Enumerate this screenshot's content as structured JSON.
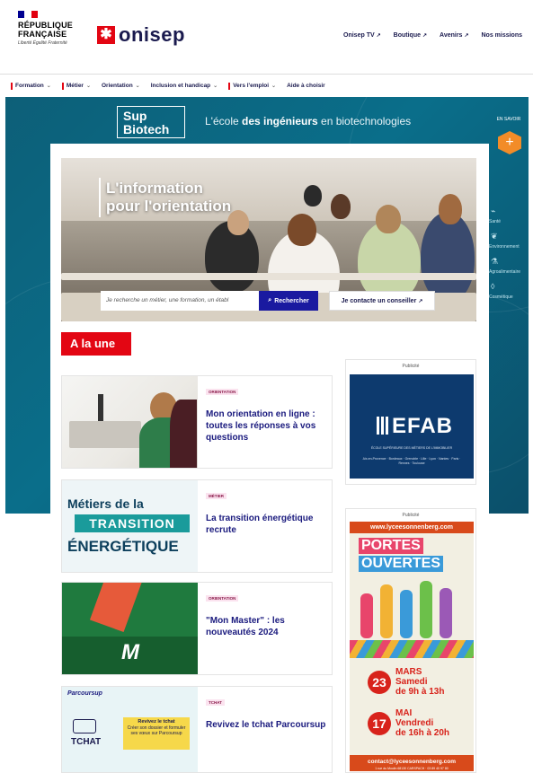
{
  "header": {
    "rf_title_line1": "RÉPUBLIQUE",
    "rf_title_line2": "FRANÇAISE",
    "rf_motto": "Liberté Égalité Fraternité",
    "logo_text": "onisep",
    "toplinks": [
      "Onisep TV",
      "Boutique",
      "Avenirs",
      "Nos missions"
    ]
  },
  "nav": {
    "items": [
      "Formation",
      "Métier",
      "Orientation",
      "Inclusion et handicap",
      "Vers l'emploi",
      "Aide à choisir"
    ]
  },
  "banner": {
    "brand_line1": "Sup",
    "brand_line2": "Biotech",
    "tagline_pre": "L'école ",
    "tagline_bold": "des ingénieurs",
    "tagline_post": " en biotechnologies",
    "side_label": "EN SAVOIR",
    "side_links": [
      "Santé",
      "Environnement",
      "Agroalimentaire",
      "Cosmétique"
    ],
    "colors": {
      "accent": "#f28c28",
      "background": "#0a6e8a"
    }
  },
  "hero": {
    "title_line1": "L'information",
    "title_line2": "pour l'orientation",
    "search_placeholder": "Je recherche un métier, une formation, un établ",
    "search_button": "Rechercher",
    "contact_button": "Je contacte un conseiller"
  },
  "section_title": "A la une",
  "cards": [
    {
      "tag": "ORIENTATION",
      "title": "Mon orientation en ligne : toutes les réponses à vos questions"
    },
    {
      "tag": "MÉTIER",
      "title": "La transition énergétique recrute",
      "thumb_line1": "Métiers de la",
      "thumb_line2": "TRANSITION",
      "thumb_line3": "ÉNERGÉTIQUE"
    },
    {
      "tag": "ORIENTATION",
      "title": "\"Mon Master\" : les nouveautés 2024",
      "thumb_text": "M"
    },
    {
      "tag": "TCHAT",
      "title": "Revivez le tchat Parcoursup",
      "thumb_brand": "Parcoursup",
      "thumb_chat": "TCHAT",
      "thumb_box_title": "Revivez le tchat",
      "thumb_box_text": "Créer son dossier et formuler ses vœux sur Parcoursup"
    }
  ],
  "ads": {
    "label": "Publicité",
    "efab": {
      "logo": "EFAB",
      "subtitle": "ÉCOLE SUPÉRIEURE DES MÉTIERS DE L'IMMOBILIER",
      "cities": "Aix-en-Provence · Bordeaux · Grenoble · Lille · Lyon · Nantes · Paris · Rennes · Toulouse"
    },
    "lycee": {
      "url": "www.lyceesonnenberg.com",
      "po_line1": "PORTES",
      "po_line2": "OUVERTES",
      "date1_num": "23",
      "date1_month": "MARS",
      "date1_day": "Samedi",
      "date1_hours": "de 9h à 13h",
      "date2_num": "17",
      "date2_month": "MAI",
      "date2_day": "Vendredi",
      "date2_hours": "de 16h à 20h",
      "contact": "contact@lyceesonnenberg.com",
      "address": "1 rue du Moulin 68130 CARSPACH · 03 89 40 97 80"
    }
  }
}
